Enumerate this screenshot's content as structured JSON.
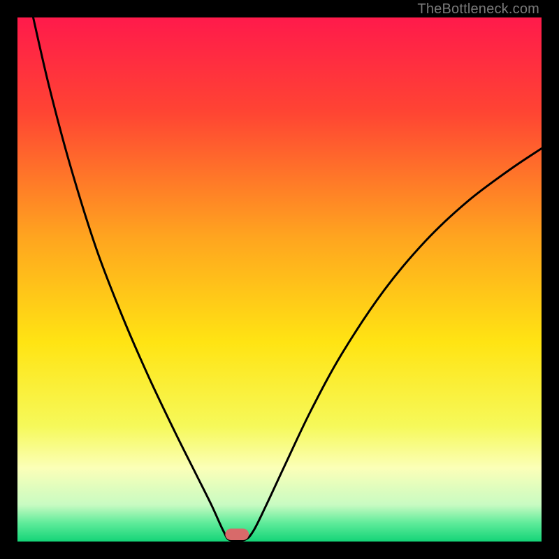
{
  "watermark": {
    "text": "TheBottleneck.com"
  },
  "chart_data": {
    "type": "line",
    "title": "",
    "xlabel": "",
    "ylabel": "",
    "xlim": [
      0,
      100
    ],
    "ylim": [
      0,
      100
    ],
    "background_gradient": [
      {
        "stop": 0.0,
        "color": "#ff1a4b"
      },
      {
        "stop": 0.18,
        "color": "#ff4433"
      },
      {
        "stop": 0.42,
        "color": "#ffa51f"
      },
      {
        "stop": 0.62,
        "color": "#ffe413"
      },
      {
        "stop": 0.78,
        "color": "#f6f95a"
      },
      {
        "stop": 0.86,
        "color": "#fbffb8"
      },
      {
        "stop": 0.93,
        "color": "#c8fbc2"
      },
      {
        "stop": 0.965,
        "color": "#5eeb9a"
      },
      {
        "stop": 1.0,
        "color": "#14d477"
      }
    ],
    "series": [
      {
        "name": "bottleneck-curve",
        "points": [
          {
            "x": 3.0,
            "y": 100.0
          },
          {
            "x": 6.0,
            "y": 87.0
          },
          {
            "x": 10.0,
            "y": 72.0
          },
          {
            "x": 15.0,
            "y": 56.0
          },
          {
            "x": 20.0,
            "y": 43.0
          },
          {
            "x": 25.0,
            "y": 31.5
          },
          {
            "x": 30.0,
            "y": 21.0
          },
          {
            "x": 34.0,
            "y": 13.0
          },
          {
            "x": 37.0,
            "y": 7.0
          },
          {
            "x": 39.3,
            "y": 2.0
          },
          {
            "x": 40.5,
            "y": 0.3
          },
          {
            "x": 43.3,
            "y": 0.3
          },
          {
            "x": 45.0,
            "y": 2.0
          },
          {
            "x": 47.5,
            "y": 7.0
          },
          {
            "x": 51.0,
            "y": 14.5
          },
          {
            "x": 56.0,
            "y": 25.0
          },
          {
            "x": 62.0,
            "y": 36.0
          },
          {
            "x": 70.0,
            "y": 48.0
          },
          {
            "x": 78.0,
            "y": 57.5
          },
          {
            "x": 86.0,
            "y": 65.0
          },
          {
            "x": 94.0,
            "y": 71.0
          },
          {
            "x": 100.0,
            "y": 75.0
          }
        ]
      }
    ],
    "marker": {
      "name": "optimum-marker",
      "x_center": 41.9,
      "width": 4.5,
      "height": 2.2,
      "color": "#d86a6a",
      "radius": 1.0
    }
  }
}
